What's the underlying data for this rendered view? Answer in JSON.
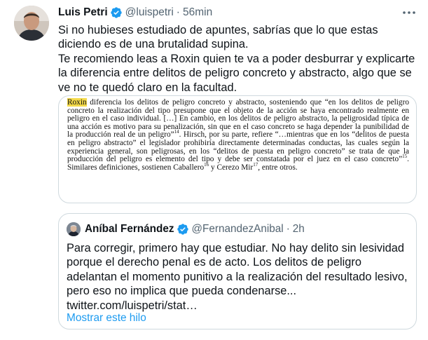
{
  "tweet": {
    "author_name": "Luis Petri",
    "handle": "@luispetri",
    "separator": "·",
    "time": "56min",
    "paragraphs": [
      "Si no hubieses estudiado de apuntes, sabrías que lo que estas diciendo es de una brutalidad supina.",
      "Te recomiendo leas a Roxin quien te va a poder desburrar y explicarte la diferencia entre delitos de peligro concreto y abstracto, algo que se ve no te quedó claro en la facultad."
    ],
    "more_icon": "more-dots-icon",
    "verified_icon": "verified-badge-icon"
  },
  "media_text": {
    "highlight": "Roxin",
    "p1": " diferencia los delitos de peligro concreto y abstracto, sosteniendo que “en los delitos de peligro concreto la realización del tipo presupone que el objeto de la acción se haya encontrado realmente en peligro en el caso individual. […] En cambio, en los delitos de peligro abstracto, la peligrosidad típica de una acción es motivo para su penalización, sin que en el caso concreto se haga depender la punibilidad de la producción real de un peligro”",
    "fn1": "14",
    "p2": ". Hirsch, por su parte, refiere “…mientras que en los “delitos de puesta en peligro abstracto” el legislador prohibiría directamente determinadas conductas, las cuales según la experiencia general, son peligrosas, en los “delitos de puesta en peligro concreto” se trata de que la producción del peligro es elemento del tipo y debe ser constatada por el juez en el caso concreto”",
    "fn2": "15",
    "p3": ". Similares definiciones, sostienen Caballero",
    "fn3": "16",
    "p4": " y Cerezo Mir",
    "fn4": "17",
    "p5": ", entre otros."
  },
  "quoted_tweet": {
    "author_name": "Aníbal Fernández",
    "handle": "@FernandezAnibal",
    "separator": "·",
    "time": "2h",
    "text_lines": [
      "Para corregir, primero hay que estudiar. No hay delito sin lesividad",
      "porque el derecho penal es de acto. Los delitos de peligro",
      "adelantan el momento punitivo a la realización del resultado lesivo,",
      "pero eso no implica que pueda condenarse...",
      "twitter.com/luispetri/stat…"
    ],
    "show_thread": "Mostrar este hilo"
  },
  "colors": {
    "accent": "#1d9bf0",
    "muted": "#536471",
    "border": "#cfd9de",
    "highlight": "#f3d94a"
  }
}
